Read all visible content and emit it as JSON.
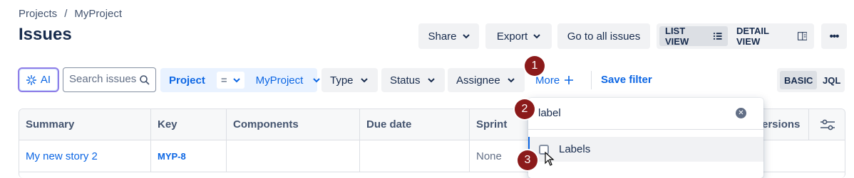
{
  "breadcrumb": {
    "items": [
      "Projects",
      "/",
      "MyProject"
    ]
  },
  "page": {
    "title": "Issues"
  },
  "toolbar": {
    "share": "Share",
    "export": "Export",
    "go_all": "Go to all issues",
    "list_view": "LIST VIEW",
    "detail_view": "DETAIL VIEW",
    "more_actions": "•••"
  },
  "filters": {
    "ai_label": "AI",
    "search_placeholder": "Search issues",
    "project_label": "Project",
    "project_operator": "=",
    "project_value": "MyProject",
    "type": "Type",
    "status": "Status",
    "assignee": "Assignee",
    "more": "More",
    "save_filter": "Save filter",
    "basic": "BASIC",
    "jql": "JQL"
  },
  "table": {
    "columns": [
      "Summary",
      "Key",
      "Components",
      "Due date",
      "Sprint",
      "ersions"
    ],
    "rows": [
      {
        "summary": "My new story 2",
        "key": "MYP-8",
        "components": "",
        "due_date": "",
        "sprint": "None"
      }
    ]
  },
  "dropdown": {
    "search_value": "label",
    "items": [
      {
        "label": "Labels",
        "checked": false
      }
    ]
  },
  "annotations": [
    "1",
    "2",
    "3"
  ],
  "colors": {
    "accent": "#0c66e4",
    "badge": "#8b1a1a",
    "ai_border": "#8f7ee7"
  }
}
